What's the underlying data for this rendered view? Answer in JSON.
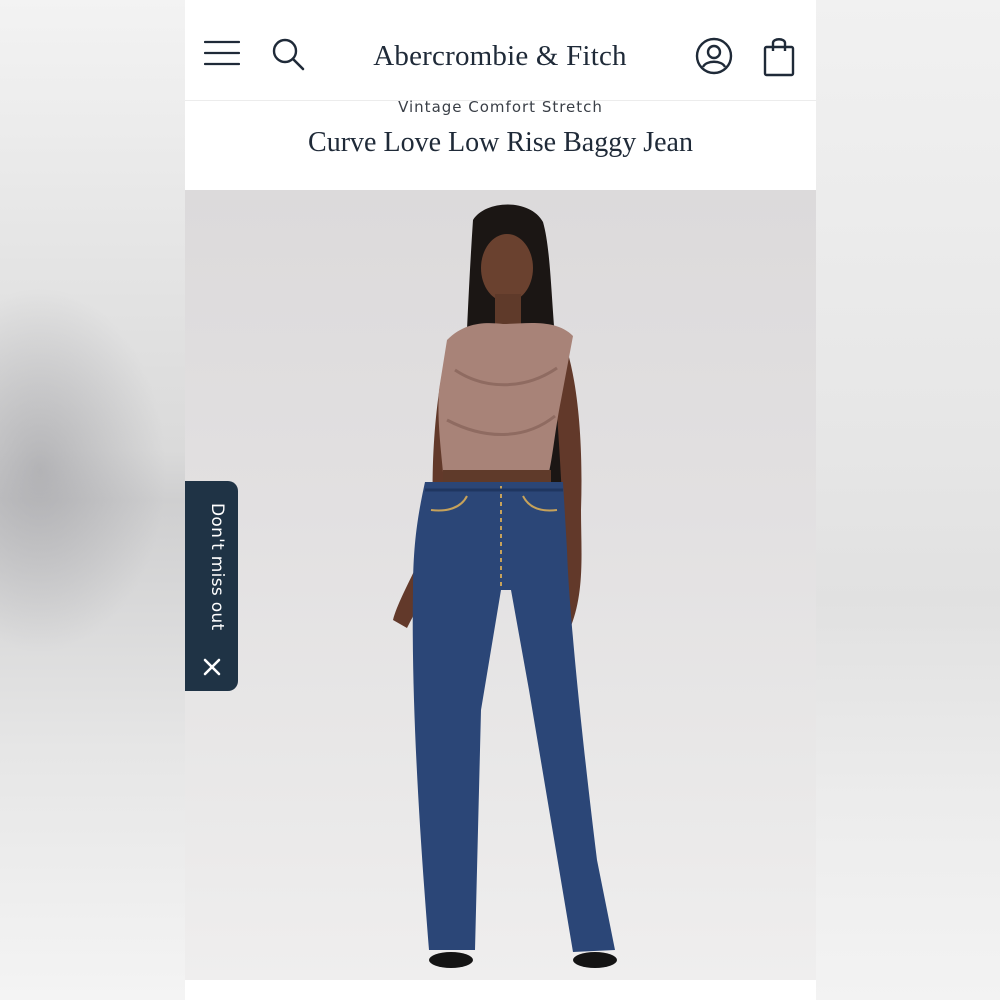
{
  "header": {
    "brand": "Abercrombie & Fitch",
    "menu_icon": "hamburger-menu-icon",
    "search_icon": "search-icon",
    "account_icon": "account-icon",
    "bag_icon": "shopping-bag-icon"
  },
  "product": {
    "collection": "Vintage Comfort Stretch",
    "title": "Curve Love Low Rise Baggy Jean"
  },
  "promo_tab": {
    "label": "Don't miss out",
    "close_icon": "close-icon"
  },
  "colors": {
    "brand_navy": "#1f2a38",
    "tab_navy": "#1f3345",
    "denim": "#2b4677",
    "top_mauve": "#a88378"
  }
}
